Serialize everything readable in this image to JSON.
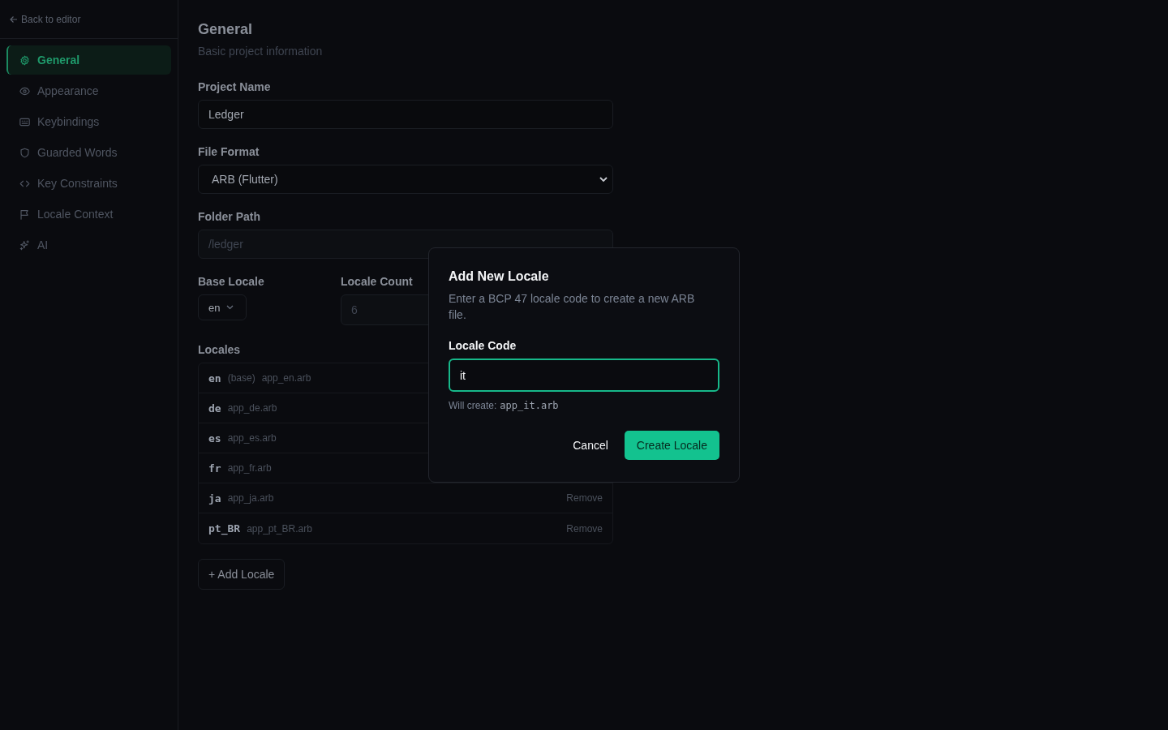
{
  "back_link": "Back to editor",
  "sidebar": {
    "items": [
      {
        "label": "General",
        "kind": "gear",
        "selected": true
      },
      {
        "label": "Appearance",
        "kind": "eye",
        "selected": false
      },
      {
        "label": "Keybindings",
        "kind": "keyboard",
        "selected": false
      },
      {
        "label": "Guarded Words",
        "kind": "shield",
        "selected": false
      },
      {
        "label": "Key Constraints",
        "kind": "code",
        "selected": false
      },
      {
        "label": "Locale Context",
        "kind": "flag",
        "selected": false
      },
      {
        "label": "AI",
        "kind": "sparkle",
        "selected": false
      }
    ]
  },
  "section": {
    "title": "General",
    "subtitle": "Basic project information"
  },
  "project_name": {
    "label": "Project Name",
    "value": "Ledger"
  },
  "file_format": {
    "label": "File Format",
    "value": "ARB (Flutter)"
  },
  "folder_path": {
    "label": "Folder Path",
    "value": "/ledger",
    "disabled": true
  },
  "base_locale": {
    "label": "Base Locale",
    "value": "en"
  },
  "locale_count": {
    "label": "Locale Count",
    "value": "6",
    "disabled": true
  },
  "locales": {
    "label": "Locales",
    "rows": [
      {
        "code": "en",
        "tag": "(base)",
        "file": "app_en.arb"
      },
      {
        "code": "de",
        "file": "app_de.arb"
      },
      {
        "code": "es",
        "file": "app_es.arb"
      },
      {
        "code": "fr",
        "file": "app_fr.arb"
      },
      {
        "code": "ja",
        "file": "app_ja.arb",
        "action": "Remove"
      },
      {
        "code": "pt_BR",
        "file": "app_pt_BR.arb",
        "action": "Remove"
      }
    ]
  },
  "add_button": "+ Add Locale",
  "dialog": {
    "title": "Add New Locale",
    "description": "Enter a BCP 47 locale code to create a new ARB file.",
    "field_label": "Locale Code",
    "value": "it",
    "hint_label": "Will create:",
    "hint_file": "app_it.arb",
    "cancel": "Cancel",
    "confirm": "Create Locale"
  }
}
